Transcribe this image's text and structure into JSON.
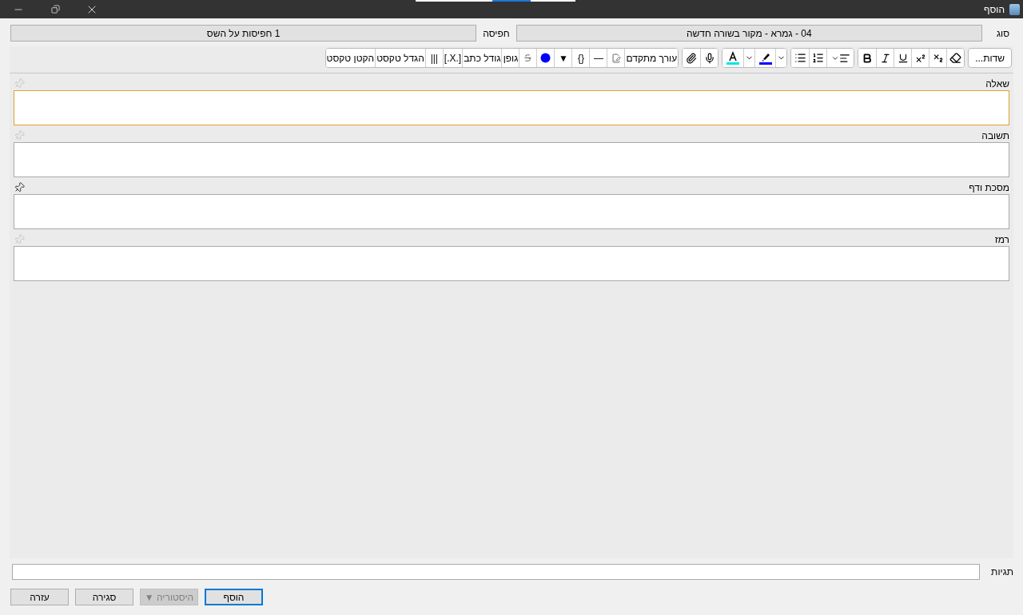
{
  "window": {
    "title": "הוסף"
  },
  "note_type": {
    "label": "סוג",
    "value": "04 - גמרא - מקור בשורה חדשה"
  },
  "deck": {
    "label": "חפיסה",
    "value": "1 חפיסות על השס"
  },
  "toolbar": {
    "fields_button": "שדות...",
    "extra": [
      "עורך מתקדם",
      "—",
      "{}",
      "▼",
      "גופן",
      "גודל כתב",
      "[.X.]",
      "|||",
      "הגדל טקסט",
      "הקטן טקסט"
    ]
  },
  "fields": [
    {
      "label": "שאלה",
      "pinned": false,
      "focused": true
    },
    {
      "label": "תשובה",
      "pinned": false,
      "focused": false
    },
    {
      "label": "מסכת ודף",
      "pinned": true,
      "focused": false
    },
    {
      "label": "רמז",
      "pinned": false,
      "focused": false
    }
  ],
  "tags": {
    "label": "תגיות"
  },
  "buttons": [
    {
      "label": "הוסף",
      "kind": "default",
      "disabled": false
    },
    {
      "label": "היסטוריה ▼",
      "kind": "normal",
      "disabled": true
    },
    {
      "label": "סגירה",
      "kind": "normal",
      "disabled": false
    },
    {
      "label": "עזרה",
      "kind": "normal",
      "disabled": false
    }
  ]
}
